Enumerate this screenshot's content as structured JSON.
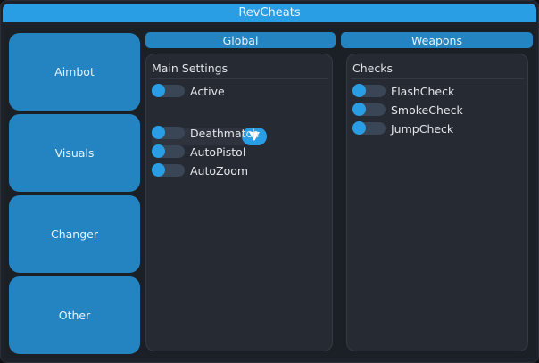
{
  "window": {
    "title": "RevCheats"
  },
  "sidebar": {
    "items": [
      {
        "label": "Aimbot"
      },
      {
        "label": "Visuals"
      },
      {
        "label": "Changer"
      },
      {
        "label": "Other"
      }
    ]
  },
  "tabs": [
    {
      "label": "Global"
    },
    {
      "label": "Weapons"
    }
  ],
  "main_settings": {
    "title": "Main Settings",
    "active": {
      "label": "Active",
      "on": false
    },
    "dropdown": {
      "value": "",
      "icon": "chevron-down-icon"
    },
    "options": [
      {
        "label": "Deathmatch",
        "on": false
      },
      {
        "label": "AutoPistol",
        "on": false
      },
      {
        "label": "AutoZoom",
        "on": false
      }
    ]
  },
  "checks": {
    "title": "Checks",
    "options": [
      {
        "label": "FlashCheck",
        "on": false
      },
      {
        "label": "SmokeCheck",
        "on": false
      },
      {
        "label": "JumpCheck",
        "on": false
      }
    ]
  },
  "colors": {
    "accent": "#2a9ee4",
    "button": "#2384c1",
    "panel": "#262a33",
    "background": "#1d2129"
  }
}
